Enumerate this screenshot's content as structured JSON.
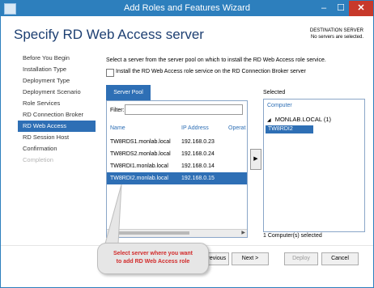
{
  "window": {
    "title": "Add Roles and Features Wizard",
    "min": "–",
    "max": "☐",
    "close": "✕"
  },
  "header": {
    "title": "Specify RD Web Access server",
    "dest_label": "DESTINATION SERVER",
    "dest_value": "No servers are selected."
  },
  "nav": {
    "items": [
      {
        "label": "Before You Begin",
        "state": "normal"
      },
      {
        "label": "Installation Type",
        "state": "normal"
      },
      {
        "label": "Deployment Type",
        "state": "normal"
      },
      {
        "label": "Deployment Scenario",
        "state": "normal"
      },
      {
        "label": "Role Services",
        "state": "normal"
      },
      {
        "label": "RD Connection Broker",
        "state": "normal"
      },
      {
        "label": "RD Web Access",
        "state": "active"
      },
      {
        "label": "RD Session Host",
        "state": "normal"
      },
      {
        "label": "Confirmation",
        "state": "normal"
      },
      {
        "label": "Completion",
        "state": "disabled"
      }
    ]
  },
  "content": {
    "intro": "Select a server from the server pool on which to install the RD Web Access role service.",
    "checkbox_label": "Install the RD Web Access role service on the RD Connection Broker server",
    "checkbox_checked": false,
    "pool_tab": "Server Pool",
    "filter_label": "Filter:",
    "filter_value": "",
    "columns": {
      "name": "Name",
      "ip": "IP Address",
      "os": "Operat"
    },
    "rows": [
      {
        "name": "TW8RDS1.monlab.local",
        "ip": "192.168.0.23",
        "selected": false
      },
      {
        "name": "TW8RDS2.monlab.local",
        "ip": "192.168.0.24",
        "selected": false
      },
      {
        "name": "TW8RDI1.monlab.local",
        "ip": "192.168.0.14",
        "selected": false
      },
      {
        "name": "TW8RDI2.monlab.local",
        "ip": "192.168.0.15",
        "selected": true
      }
    ],
    "move_arrow": "▶",
    "scroll_left": "◀",
    "scroll_right": "▶",
    "selected_label": "Selected",
    "selected_col": "Computer",
    "selected_group": "MONLAB.LOCAL (1)",
    "selected_group_arrow": "◢",
    "selected_item": "TW8RDI2",
    "selected_count": "1 Computer(s) selected"
  },
  "buttons": {
    "previous": "< Previous",
    "next": "Next >",
    "deploy": "Deploy",
    "cancel": "Cancel"
  },
  "callout": {
    "line1": "Select server where you want",
    "line2": "to add RD Web Access role"
  },
  "colors": {
    "accent": "#2e6fb5",
    "titlebar": "#2d7fbd",
    "callout_text": "#d22b2b"
  }
}
